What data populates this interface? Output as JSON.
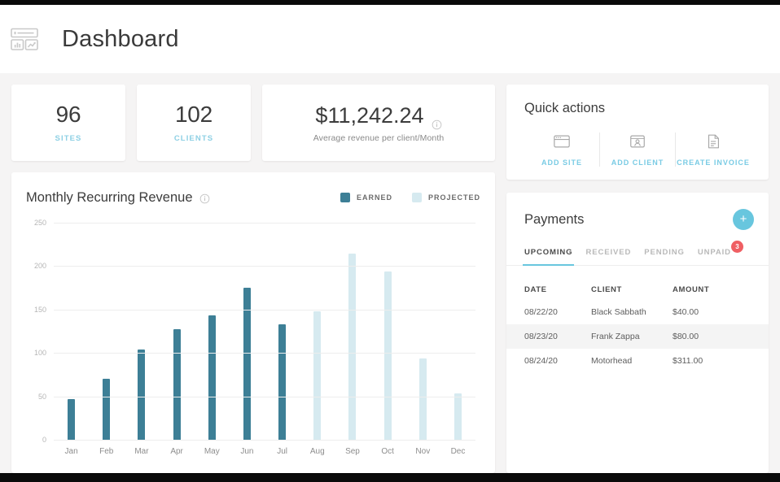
{
  "header": {
    "title": "Dashboard",
    "icon": "dashboard-layout-icon"
  },
  "stats": [
    {
      "value": "96",
      "label": "SITES"
    },
    {
      "value": "102",
      "label": "CLIENTS"
    }
  ],
  "revenue_stat": {
    "value": "$11,242.24",
    "subtitle": "Average revenue per client/Month",
    "info_icon": "info-circle-icon"
  },
  "quick_actions": {
    "title": "Quick actions",
    "items": [
      {
        "label": "ADD SITE",
        "icon": "browser-window-icon"
      },
      {
        "label": "ADD CLIENT",
        "icon": "client-card-icon"
      },
      {
        "label": "CREATE INVOICE",
        "icon": "document-icon"
      }
    ]
  },
  "chart_card": {
    "title": "Monthly Recurring Revenue",
    "info_icon": "info-circle-icon"
  },
  "chart_data": {
    "type": "bar",
    "title": "Monthly Recurring Revenue",
    "xlabel": "",
    "ylabel": "",
    "ylim": [
      0,
      250
    ],
    "yticks": [
      0,
      50,
      100,
      150,
      200,
      250
    ],
    "ytick_labels": [
      "0",
      "50",
      "100",
      "150",
      "200",
      "250"
    ],
    "grid": true,
    "legend_position": "top-right",
    "categories": [
      "Jan",
      "Feb",
      "Mar",
      "Apr",
      "May",
      "Jun",
      "Jul",
      "Aug",
      "Sep",
      "Oct",
      "Nov",
      "Dec"
    ],
    "values": [
      47,
      70,
      104,
      127,
      143,
      175,
      133,
      148,
      214,
      194,
      94,
      53
    ],
    "series_of_bar": [
      "earned",
      "earned",
      "earned",
      "earned",
      "earned",
      "earned",
      "earned",
      "projected",
      "projected",
      "projected",
      "projected",
      "projected"
    ],
    "series": [
      {
        "name": "EARNED",
        "color": "#3d7f96",
        "values": [
          47,
          70,
          104,
          127,
          143,
          175,
          133,
          null,
          null,
          null,
          null,
          null
        ]
      },
      {
        "name": "PROJECTED",
        "color": "#d6eaf0",
        "values": [
          null,
          null,
          null,
          null,
          null,
          null,
          null,
          148,
          214,
          194,
          94,
          53
        ]
      }
    ],
    "legend": [
      {
        "label": "EARNED",
        "color": "#3d7f96"
      },
      {
        "label": "PROJECTED",
        "color": "#d6eaf0"
      }
    ]
  },
  "payments": {
    "title": "Payments",
    "add_label": "+",
    "tabs": [
      {
        "label": "UPCOMING",
        "active": true,
        "badge": null
      },
      {
        "label": "RECEIVED",
        "active": false,
        "badge": null
      },
      {
        "label": "PENDING",
        "active": false,
        "badge": null
      },
      {
        "label": "UNPAID",
        "active": false,
        "badge": "3"
      }
    ],
    "columns": [
      "DATE",
      "CLIENT",
      "AMOUNT"
    ],
    "rows": [
      {
        "date": "08/22/20",
        "client": "Black Sabbath",
        "amount": "$40.00"
      },
      {
        "date": "08/23/20",
        "client": "Frank Zappa",
        "amount": "$80.00"
      },
      {
        "date": "08/24/20",
        "client": "Motorhead",
        "amount": "$311.00"
      }
    ]
  },
  "colors": {
    "accent": "#68c6de",
    "earned": "#3d7f96",
    "projected": "#d6eaf0",
    "badge": "#ef5f63",
    "page_bg": "#f5f4f4"
  }
}
